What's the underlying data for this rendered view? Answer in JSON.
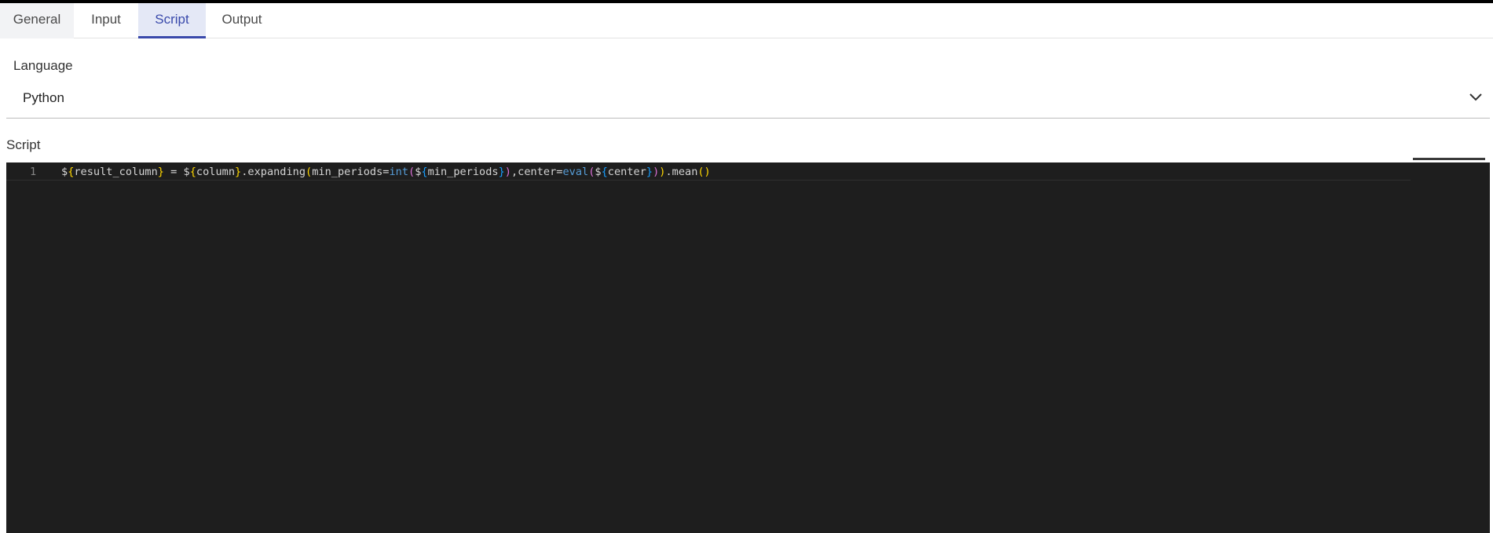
{
  "tabs": [
    {
      "label": "General"
    },
    {
      "label": "Input"
    },
    {
      "label": "Script"
    },
    {
      "label": "Output"
    }
  ],
  "active_tab": "Script",
  "language": {
    "label": "Language",
    "value": "Python",
    "icon": "chevron-down-icon"
  },
  "script": {
    "label": "Script",
    "lines": [
      {
        "number": "1",
        "tokens": [
          {
            "t": "$",
            "c": "plain"
          },
          {
            "t": "{",
            "c": "brace"
          },
          {
            "t": "result_column",
            "c": "plain"
          },
          {
            "t": "}",
            "c": "brace"
          },
          {
            "t": " = $",
            "c": "plain"
          },
          {
            "t": "{",
            "c": "brace"
          },
          {
            "t": "column",
            "c": "plain"
          },
          {
            "t": "}",
            "c": "brace"
          },
          {
            "t": ".expanding",
            "c": "plain"
          },
          {
            "t": "(",
            "c": "brace"
          },
          {
            "t": "min_periods=",
            "c": "plain"
          },
          {
            "t": "int",
            "c": "builtin"
          },
          {
            "t": "(",
            "c": "brace2"
          },
          {
            "t": "$",
            "c": "plain"
          },
          {
            "t": "{",
            "c": "brace3"
          },
          {
            "t": "min_periods",
            "c": "plain"
          },
          {
            "t": "}",
            "c": "brace3"
          },
          {
            "t": ")",
            "c": "brace2"
          },
          {
            "t": ",center=",
            "c": "plain"
          },
          {
            "t": "eval",
            "c": "builtin"
          },
          {
            "t": "(",
            "c": "brace2"
          },
          {
            "t": "$",
            "c": "plain"
          },
          {
            "t": "{",
            "c": "brace3"
          },
          {
            "t": "center",
            "c": "plain"
          },
          {
            "t": "}",
            "c": "brace3"
          },
          {
            "t": ")",
            "c": "brace2"
          },
          {
            "t": ")",
            "c": "brace"
          },
          {
            "t": ".mean",
            "c": "plain"
          },
          {
            "t": "()",
            "c": "brace"
          }
        ]
      }
    ]
  },
  "colors": {
    "accent": "#3949ab",
    "editor_bg": "#1e1e1e"
  }
}
